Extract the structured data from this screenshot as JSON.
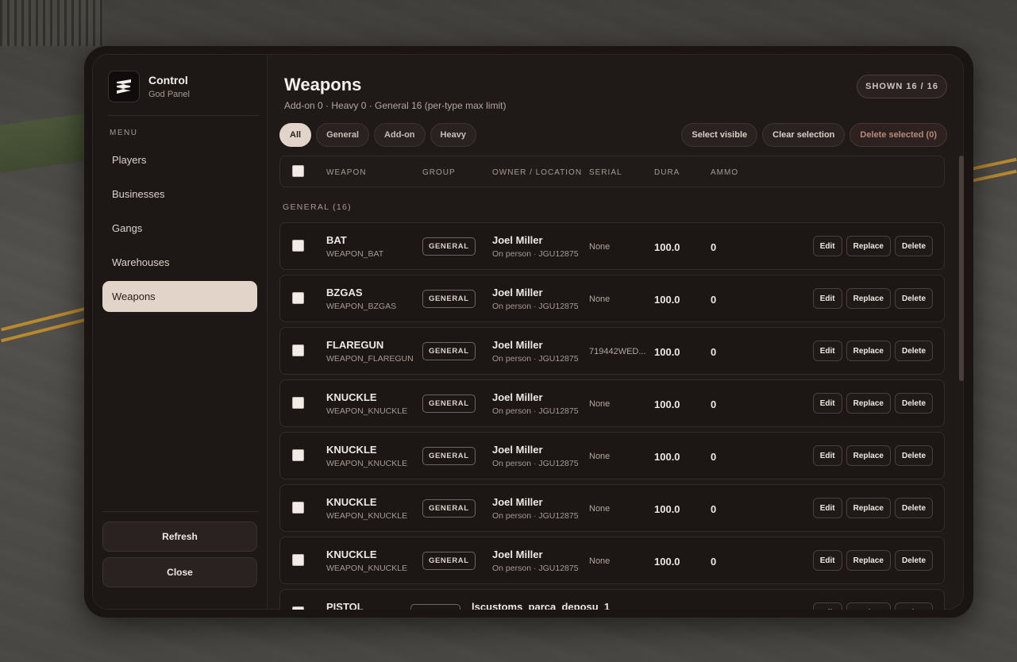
{
  "brand": {
    "title": "Control",
    "subtitle": "God Panel"
  },
  "menu_label": "MENU",
  "nav": [
    "Players",
    "Businesses",
    "Gangs",
    "Warehouses",
    "Weapons"
  ],
  "nav_active": "Weapons",
  "sidebar_buttons": {
    "refresh": "Refresh",
    "close": "Close"
  },
  "header": {
    "title": "Weapons",
    "subtitle": "Add-on 0 · Heavy 0 · General 16 (per-type max limit)",
    "shown": "SHOWN 16 / 16"
  },
  "filters": [
    "All",
    "General",
    "Add-on",
    "Heavy"
  ],
  "filter_active": "All",
  "actions": {
    "select_visible": "Select visible",
    "clear_selection": "Clear selection",
    "delete_selected": "Delete selected (0)"
  },
  "columns": {
    "weapon": "WEAPON",
    "group": "GROUP",
    "owner": "OWNER / LOCATION",
    "serial": "SERIAL",
    "dura": "DURA",
    "ammo": "AMMO"
  },
  "group_label": "GENERAL (16)",
  "row_buttons": {
    "edit": "Edit",
    "replace": "Replace",
    "delete": "Delete"
  },
  "rows": [
    {
      "name": "BAT",
      "code": "WEAPON_BAT",
      "group": "GENERAL",
      "owner": "Joel Miller",
      "location": "On person · JGU12875",
      "serial": "None",
      "dura": "100.0",
      "ammo": "0"
    },
    {
      "name": "BZGAS",
      "code": "WEAPON_BZGAS",
      "group": "GENERAL",
      "owner": "Joel Miller",
      "location": "On person · JGU12875",
      "serial": "None",
      "dura": "100.0",
      "ammo": "0"
    },
    {
      "name": "FLAREGUN",
      "code": "WEAPON_FLAREGUN",
      "group": "GENERAL",
      "owner": "Joel Miller",
      "location": "On person · JGU12875",
      "serial": "719442WED...",
      "dura": "100.0",
      "ammo": "0"
    },
    {
      "name": "KNUCKLE",
      "code": "WEAPON_KNUCKLE",
      "group": "GENERAL",
      "owner": "Joel Miller",
      "location": "On person · JGU12875",
      "serial": "None",
      "dura": "100.0",
      "ammo": "0"
    },
    {
      "name": "KNUCKLE",
      "code": "WEAPON_KNUCKLE",
      "group": "GENERAL",
      "owner": "Joel Miller",
      "location": "On person · JGU12875",
      "serial": "None",
      "dura": "100.0",
      "ammo": "0"
    },
    {
      "name": "KNUCKLE",
      "code": "WEAPON_KNUCKLE",
      "group": "GENERAL",
      "owner": "Joel Miller",
      "location": "On person · JGU12875",
      "serial": "None",
      "dura": "100.0",
      "ammo": "0"
    },
    {
      "name": "KNUCKLE",
      "code": "WEAPON_KNUCKLE",
      "group": "GENERAL",
      "owner": "Joel Miller",
      "location": "On person · JGU12875",
      "serial": "None",
      "dura": "100.0",
      "ammo": "0"
    },
    {
      "name": "PISTOL",
      "code": "",
      "group": "",
      "owner": "lscustoms_parca_deposu_1",
      "location": "",
      "serial": "",
      "dura": "",
      "ammo": ""
    }
  ]
}
